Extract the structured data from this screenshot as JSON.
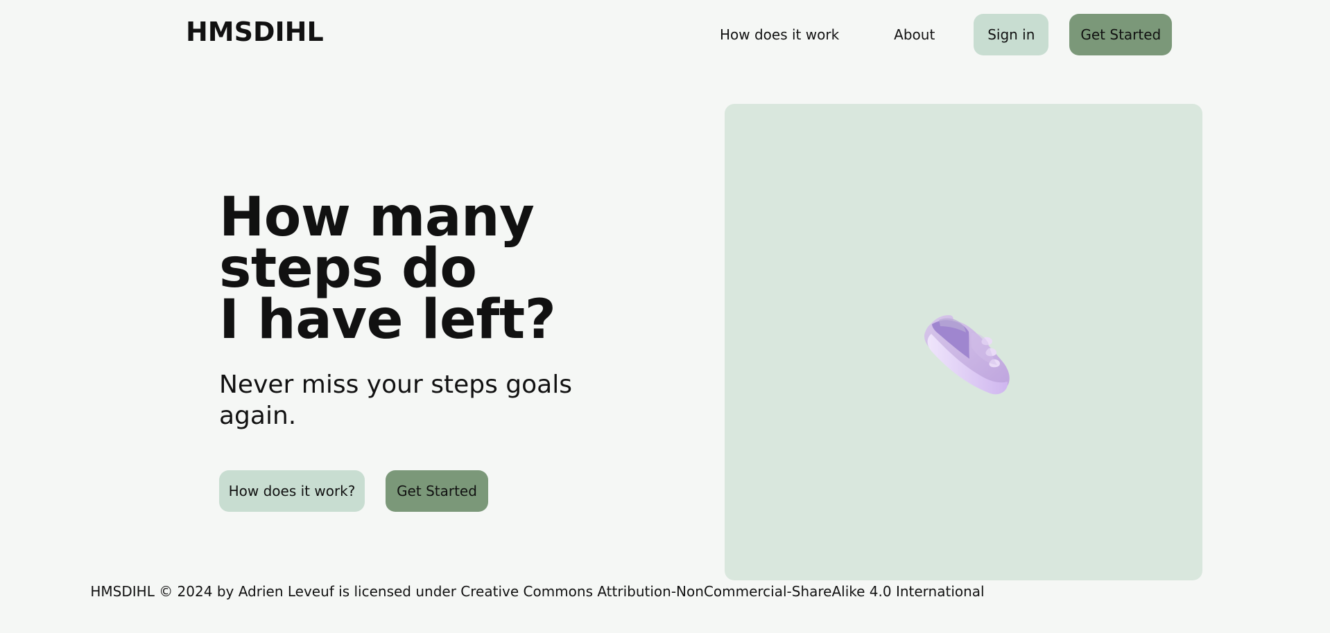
{
  "header": {
    "brand": "HMSDIHL",
    "nav": {
      "how_label": "How does it work",
      "about_label": "About",
      "signin_label": "Sign in",
      "get_started_label": "Get Started"
    }
  },
  "hero": {
    "title_lines": [
      "How many",
      "steps do",
      "I have left?"
    ],
    "subtitle": "Never miss your steps goals again.",
    "buttons": {
      "how_label": "How does it work?",
      "start_label": "Get Started"
    }
  },
  "image": {
    "icon": "running-shoe-icon"
  },
  "footer": {
    "text": "HMSDIHL © 2024 by Adrien Leveuf is licensed under Creative Commons Attribution-NonCommercial-ShareAlike 4.0 International"
  },
  "colors": {
    "background": "#f5f7f5",
    "light_button": "#c8ddd1",
    "dark_button": "#7b9879",
    "image_panel": "#d9e7dd",
    "shoe": "#c8b3e3"
  }
}
